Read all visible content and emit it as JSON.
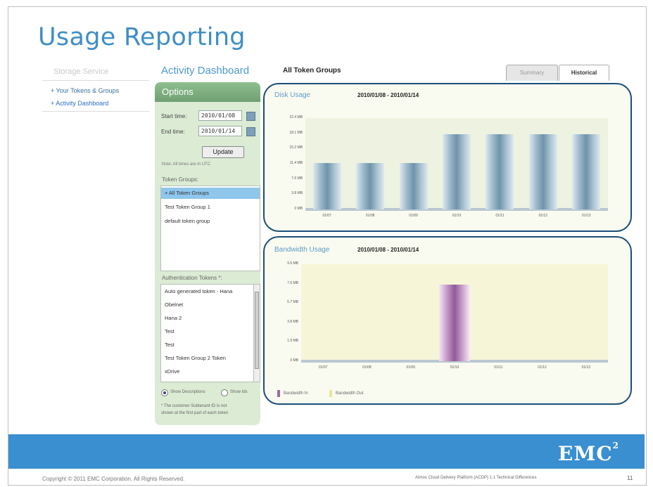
{
  "title": "Usage Reporting",
  "nav": {
    "heading": "Storage Service",
    "items": [
      "+ Your Tokens & Groups",
      "+ Activity Dashboard"
    ]
  },
  "activity_dashboard": "Activity Dashboard",
  "options": {
    "header": "Options",
    "start_label": "Start time:",
    "start_value": "2010/01/08",
    "end_label": "End time:",
    "end_value": "2010/01/14",
    "update_label": "Update",
    "note": "Note: All times are in UTC",
    "token_groups_label": "Token Groups:",
    "token_groups": [
      "+ All Token Groups",
      "Test Token Group 1",
      "default token group"
    ],
    "auth_tokens_label": "Authentication Tokens *:",
    "auth_tokens": [
      "Auto generated token - Hana",
      "Obelnet",
      "Hana 2",
      "Test",
      "Test",
      "Test Token Group 2 Token",
      "xDrive"
    ],
    "radio_1": "Show Descriptions",
    "radio_2": "Show Ids",
    "footnote_1": "* The customer Subtenant ID is not",
    "footnote_2": "shown at the first part of each token"
  },
  "all_groups": "All Token Groups",
  "tabs": {
    "summary": "Summary",
    "historical": "Historical"
  },
  "disk": {
    "title": "Disk Usage",
    "range": "2010/01/08 - 2010/01/14"
  },
  "bandwidth": {
    "title": "Bandwidth Usage",
    "range": "2010/01/08 - 2010/01/14",
    "legend_in": "Bandwidth In",
    "legend_out": "Bandwidth Out",
    "color_in": "#9b6ba3",
    "color_out": "#ece69a"
  },
  "chart_data": [
    {
      "type": "bar",
      "title": "Disk Usage",
      "categories": [
        "01/07",
        "01/08",
        "01/09",
        "01/10",
        "01/11",
        "01/12",
        "01/13"
      ],
      "values": [
        11.4,
        11.4,
        11.4,
        18.4,
        18.4,
        18.4,
        18.4
      ],
      "y_ticks": [
        "22.4 MB",
        "18.1 MB",
        "15.2 MB",
        "11.4 MB",
        "7.6 MB",
        "3.8 MB",
        "0 MB"
      ],
      "ylim": [
        0,
        22.4
      ]
    },
    {
      "type": "bar",
      "title": "Bandwidth Usage",
      "categories": [
        "01/07",
        "01/08",
        "01/09",
        "01/10",
        "01/11",
        "01/12",
        "01/13"
      ],
      "series": [
        {
          "name": "Bandwidth In",
          "values": [
            0,
            0,
            0,
            7.6,
            0,
            0,
            0
          ]
        },
        {
          "name": "Bandwidth Out",
          "values": [
            0,
            0,
            0,
            0,
            0,
            0,
            0
          ]
        }
      ],
      "y_ticks": [
        "9.6 MB",
        "7.6 MB",
        "5.7 MB",
        "3.8 MB",
        "1.9 MB",
        "0 MB"
      ],
      "ylim": [
        0,
        9.6
      ]
    }
  ],
  "brand": {
    "name": "EMC",
    "sup": "2"
  },
  "footer": {
    "copyright": "Copyright © 2011 EMC Corporation. All Rights Reserved.",
    "doc": "Atmos Cloud Delivery Platform (ACDP) 1.1 Technical Differences",
    "page": "11"
  }
}
